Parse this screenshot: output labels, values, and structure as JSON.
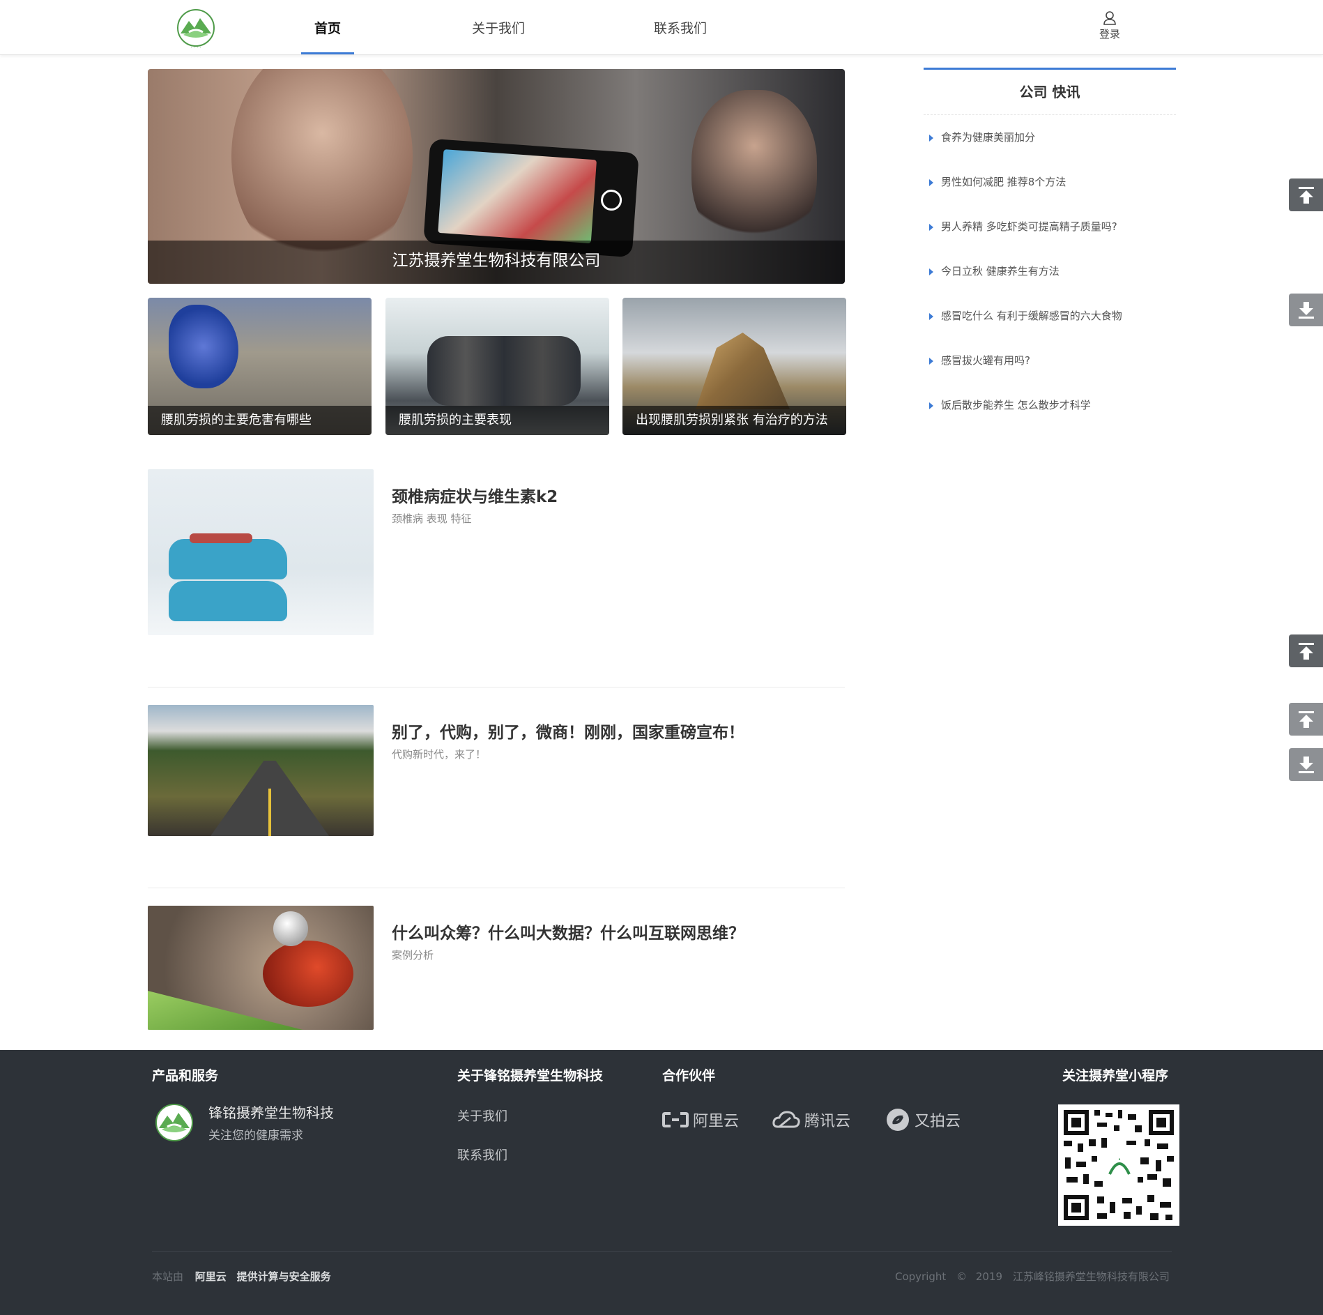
{
  "header": {
    "nav": [
      {
        "label": "首页",
        "active": true
      },
      {
        "label": "关于我们",
        "active": false
      },
      {
        "label": "联系我们",
        "active": false
      }
    ],
    "login_label": "登录",
    "accent_color": "#3d7bd5",
    "logo_icon": "company-logo-icon",
    "user_icon": "user-icon"
  },
  "hero": {
    "caption": "江苏摄养堂生物科技有限公司"
  },
  "thumbs": [
    {
      "caption": "腰肌劳损的主要危害有哪些"
    },
    {
      "caption": "腰肌劳损的主要表现"
    },
    {
      "caption": "出现腰肌劳损别紧张 有治疗的方法"
    }
  ],
  "articles": [
    {
      "title": "颈椎病症状与维生素k2",
      "tags": "颈椎病 表现 特征"
    },
    {
      "title": "别了，代购，别了，微商！刚刚，国家重磅宣布！",
      "tags": "代购新时代，来了！"
    },
    {
      "title": "什么叫众筹？什么叫大数据？什么叫互联网思维？",
      "tags": "案例分析"
    }
  ],
  "sidebar": {
    "title": "公司 快讯",
    "items": [
      "食养为健康美丽加分",
      "男性如何减肥 推荐8个方法",
      "男人养精 多吃虾类可提高精子质量吗?",
      "今日立秋 健康养生有方法",
      "感冒吃什么 有利于缓解感冒的六大食物",
      "感冒拔火罐有用吗?",
      "饭后散步能养生 怎么散步才科学"
    ]
  },
  "floating": {
    "icons": [
      "to-top-icon",
      "to-bottom-icon"
    ]
  },
  "footer": {
    "col1": {
      "heading": "产品和服务",
      "brand_name": "锋铭摄养堂生物科技",
      "brand_slogan": "关注您的健康需求"
    },
    "col2": {
      "heading": "关于锋铭摄养堂生物科技",
      "links": [
        "关于我们",
        "联系我们"
      ]
    },
    "col3": {
      "heading": "合作伙伴",
      "partners": [
        "阿里云",
        "腾讯云",
        "又拍云"
      ]
    },
    "col4": {
      "heading": "关注摄养堂小程序"
    },
    "bottom_left": {
      "prefix": "本站由",
      "provider": "阿里云",
      "service": "提供计算与安全服务"
    },
    "copyright": {
      "label": "Copyright",
      "symbol": "©",
      "year": "2019",
      "company": "江苏峰铭摄养堂生物科技有限公司"
    }
  }
}
